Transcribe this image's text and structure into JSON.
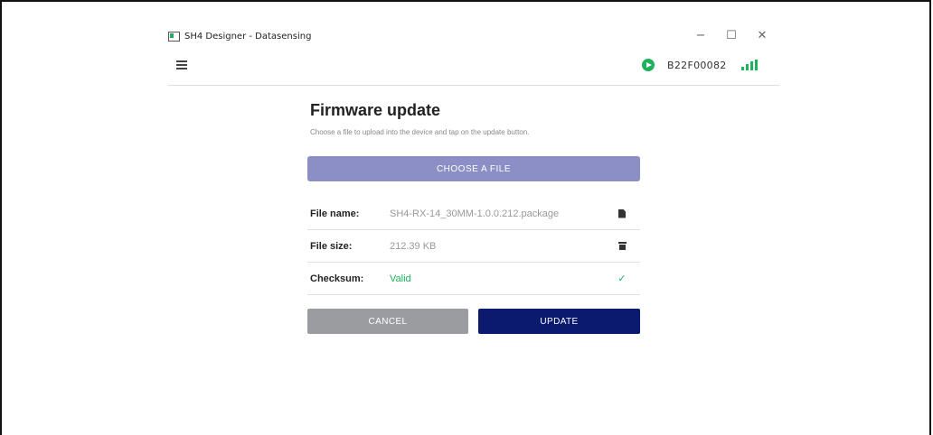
{
  "window": {
    "title": "SH4 Designer - Datasensing",
    "minimize": "−",
    "maximize": "☐",
    "close": "✕"
  },
  "header": {
    "device_id": "B22F00082",
    "status_icon": "play-circle-icon",
    "signal_icon": "signal-bars-icon",
    "accent_color": "#1fb25a"
  },
  "page": {
    "title": "Firmware update",
    "subtitle": "Choose a file to upload into the device and tap on the update button.",
    "choose_file_label": "CHOOSE A FILE"
  },
  "file_info": {
    "rows": [
      {
        "label": "File name:",
        "value": "SH4-RX-14_30MM-1.0.0.212.package",
        "icon": "document-icon"
      },
      {
        "label": "File size:",
        "value": "212.39 KB",
        "icon": "archive-icon"
      },
      {
        "label": "Checksum:",
        "value": "Valid",
        "icon": "check-icon"
      }
    ]
  },
  "actions": {
    "cancel_label": "CANCEL",
    "update_label": "UPDATE",
    "update_color": "#0b1a6e",
    "cancel_color": "#9a9c9f"
  }
}
